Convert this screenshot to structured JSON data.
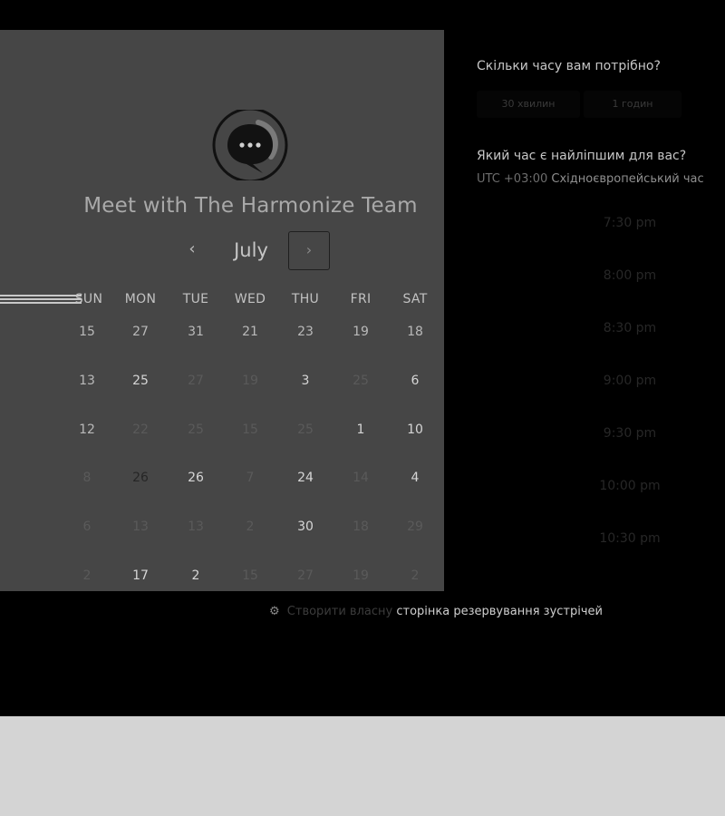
{
  "booking": {
    "title": "Meet with The Harmonize Team",
    "month": "July",
    "prev_icon": "‹",
    "next_icon": "›",
    "weekdays": [
      "SUN",
      "MON",
      "TUE",
      "WED",
      "THU",
      "FRI",
      "SAT"
    ],
    "weeks": [
      [
        {
          "d": "15",
          "s": "on"
        },
        {
          "d": "27",
          "s": "on"
        },
        {
          "d": "31",
          "s": "on"
        },
        {
          "d": "21",
          "s": "on"
        },
        {
          "d": "23",
          "s": "on"
        },
        {
          "d": "19",
          "s": "on"
        },
        {
          "d": "18",
          "s": "on"
        }
      ],
      [
        {
          "d": "13",
          "s": "on"
        },
        {
          "d": "25",
          "s": "avail"
        },
        {
          "d": "27",
          "s": "off"
        },
        {
          "d": "19",
          "s": "off"
        },
        {
          "d": "3",
          "s": "avail"
        },
        {
          "d": "25",
          "s": "off"
        },
        {
          "d": "6",
          "s": "avail"
        }
      ],
      [
        {
          "d": "12",
          "s": "on"
        },
        {
          "d": "22",
          "s": "off"
        },
        {
          "d": "25",
          "s": "off"
        },
        {
          "d": "15",
          "s": "off"
        },
        {
          "d": "25",
          "s": "off"
        },
        {
          "d": "1",
          "s": "avail"
        },
        {
          "d": "10",
          "s": "avail"
        }
      ],
      [
        {
          "d": "8",
          "s": "off"
        },
        {
          "d": "26",
          "s": "selected"
        },
        {
          "d": "26",
          "s": "avail"
        },
        {
          "d": "7",
          "s": "off"
        },
        {
          "d": "24",
          "s": "avail"
        },
        {
          "d": "14",
          "s": "off"
        },
        {
          "d": "4",
          "s": "avail"
        }
      ],
      [
        {
          "d": "6",
          "s": "off"
        },
        {
          "d": "13",
          "s": "off"
        },
        {
          "d": "13",
          "s": "off"
        },
        {
          "d": "2",
          "s": "off"
        },
        {
          "d": "30",
          "s": "avail"
        },
        {
          "d": "18",
          "s": "off"
        },
        {
          "d": "29",
          "s": "off"
        }
      ],
      [
        {
          "d": "2",
          "s": "off"
        },
        {
          "d": "17",
          "s": "avail"
        },
        {
          "d": "2",
          "s": "avail"
        },
        {
          "d": "15",
          "s": "off"
        },
        {
          "d": "27",
          "s": "off"
        },
        {
          "d": "19",
          "s": "off"
        },
        {
          "d": "2",
          "s": "off"
        }
      ]
    ]
  },
  "duration": {
    "question": "Скільки часу вам потрібно?",
    "options": [
      "30 хвилин",
      "1 годин"
    ]
  },
  "time": {
    "question": "Який час є найліпшим для вас?",
    "tz_offset": "UTC +03:00",
    "tz_name": "Східноєвропейський час",
    "slots": [
      "7:30 pm",
      "8:00 pm",
      "8:30 pm",
      "9:00 pm",
      "9:30 pm",
      "10:00 pm",
      "10:30 pm"
    ]
  },
  "footer": {
    "prefix": "Створити власну",
    "link": "сторінка резервування зустрічей"
  },
  "icons": {
    "logo": "chat-bubble-logo-icon",
    "footer": "sprocket-icon"
  },
  "colors": {
    "panel": "#464646",
    "background": "#000000",
    "selected_day": "#9c9c9c"
  }
}
